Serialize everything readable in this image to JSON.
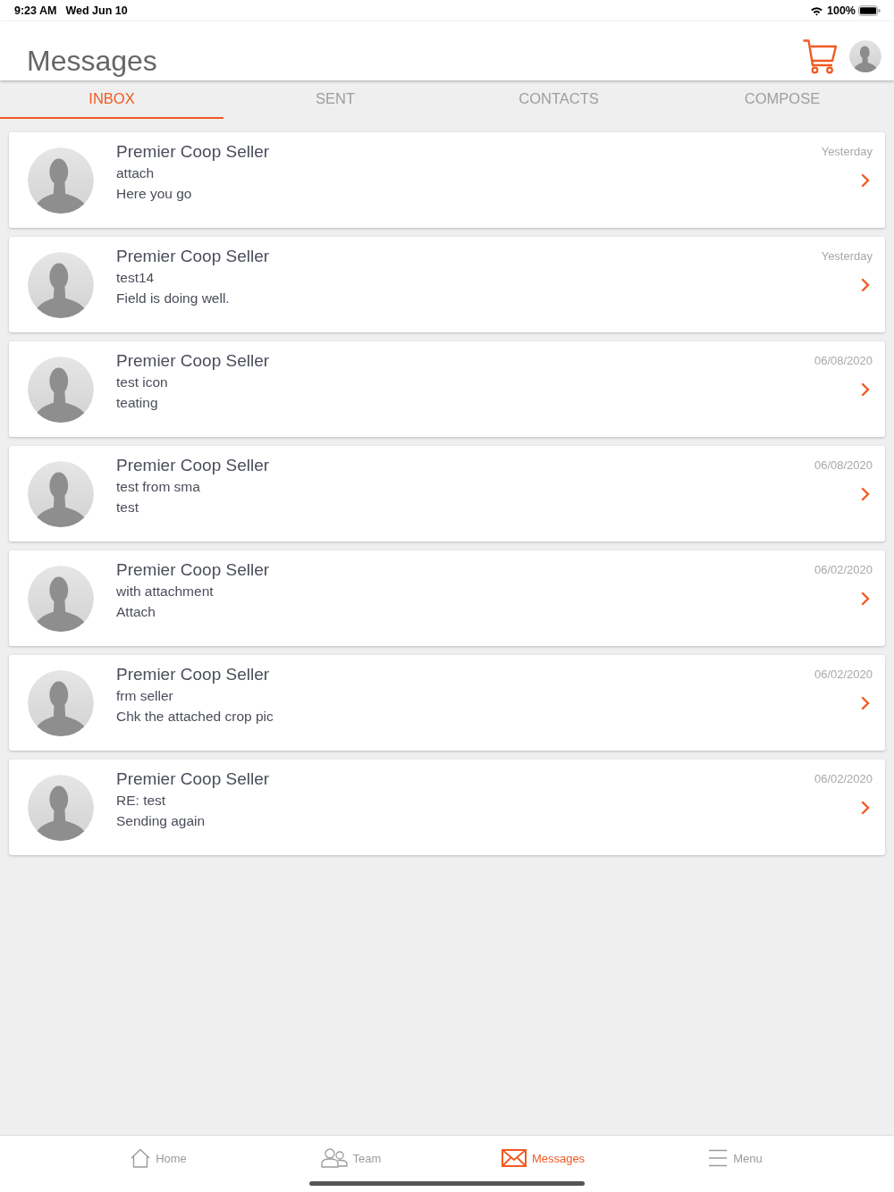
{
  "status_bar": {
    "time": "9:23 AM",
    "date": "Wed Jun 10",
    "battery": "100%"
  },
  "header": {
    "title": "Messages"
  },
  "tabs": [
    {
      "label": "INBOX",
      "selected": true
    },
    {
      "label": "SENT",
      "selected": false
    },
    {
      "label": "CONTACTS",
      "selected": false
    },
    {
      "label": "COMPOSE",
      "selected": false
    }
  ],
  "messages": [
    {
      "sender": "Premier Coop Seller",
      "subject": "attach",
      "preview": "Here you go",
      "date": "Yesterday"
    },
    {
      "sender": "Premier Coop Seller",
      "subject": "test14",
      "preview": "Field is doing well.",
      "date": "Yesterday"
    },
    {
      "sender": "Premier Coop Seller",
      "subject": "test icon",
      "preview": "teating",
      "date": "06/08/2020"
    },
    {
      "sender": "Premier Coop Seller",
      "subject": "test from sma",
      "preview": "test",
      "date": "06/08/2020"
    },
    {
      "sender": "Premier Coop Seller",
      "subject": "with attachment",
      "preview": "Attach",
      "date": "06/02/2020"
    },
    {
      "sender": "Premier Coop Seller",
      "subject": "frm seller",
      "preview": "Chk the attached crop pic",
      "date": "06/02/2020"
    },
    {
      "sender": "Premier Coop Seller",
      "subject": "RE: test",
      "preview": "Sending again",
      "date": "06/02/2020"
    }
  ],
  "bottom_nav": [
    {
      "kind": "home",
      "label": "Home",
      "selected": false
    },
    {
      "kind": "team",
      "label": "Team",
      "selected": false
    },
    {
      "kind": "messages",
      "label": "Messages",
      "selected": true
    },
    {
      "kind": "menu",
      "label": "Menu",
      "selected": false
    }
  ]
}
